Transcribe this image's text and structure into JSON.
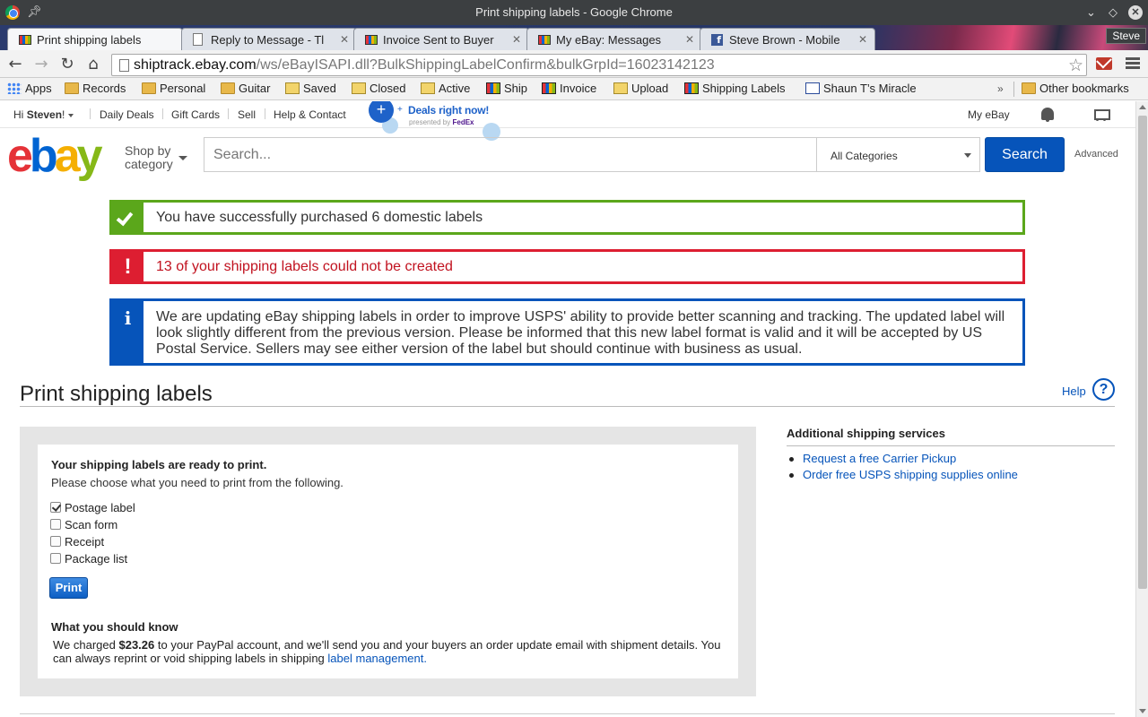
{
  "window": {
    "title": "Print shipping labels - Google Chrome"
  },
  "tabs": [
    {
      "label": "Print shipping labels",
      "icon": "ebay-favicon",
      "active": true
    },
    {
      "label": "Reply to Message - Tl",
      "icon": "page-favicon"
    },
    {
      "label": "Invoice Sent to Buyer",
      "icon": "ebay-favicon"
    },
    {
      "label": "My eBay: Messages",
      "icon": "ebay-favicon"
    },
    {
      "label": "Steve Brown - Mobile",
      "icon": "facebook-favicon"
    }
  ],
  "profile": {
    "name": "Steve"
  },
  "omnibox": {
    "host": "shiptrack.ebay.com",
    "path": "/ws/eBayISAPI.dll?BulkShippingLabelConfirm&bulkGrpId=16023142123"
  },
  "bookmarks": [
    {
      "label": "Apps",
      "icon": "apps"
    },
    {
      "label": "Records",
      "icon": "folder"
    },
    {
      "label": "Personal",
      "icon": "folder"
    },
    {
      "label": "Guitar",
      "icon": "folder"
    },
    {
      "label": "Saved",
      "icon": "graph"
    },
    {
      "label": "Closed",
      "icon": "graph"
    },
    {
      "label": "Active",
      "icon": "graph"
    },
    {
      "label": "Ship",
      "icon": "ebay"
    },
    {
      "label": "Invoice",
      "icon": "ebay"
    },
    {
      "label": "Upload",
      "icon": "graph"
    },
    {
      "label": "Shipping Labels",
      "icon": "ebay"
    },
    {
      "label": "Shaun T’s Miracle",
      "icon": "logo"
    },
    {
      "label": "Other bookmarks",
      "icon": "folder"
    }
  ],
  "bookmarks_more": "»",
  "header": {
    "greeting_prefix": "Hi",
    "user": "Steven",
    "greeting_suffix": "!",
    "links": [
      "Daily Deals",
      "Gift Cards",
      "Sell",
      "Help & Contact"
    ],
    "promo_title": "Deals right now!",
    "promo_sub_prefix": "presented by",
    "promo_sub_brand": "FedEx",
    "my_ebay": "My eBay"
  },
  "logo": {
    "e": "e",
    "b": "b",
    "a": "a",
    "y": "y"
  },
  "search": {
    "shop_by_line1": "Shop by",
    "shop_by_line2": "category",
    "placeholder": "Search...",
    "category": "All Categories",
    "button": "Search",
    "advanced": "Advanced"
  },
  "messages": {
    "success": "You have successfully purchased 6 domestic labels",
    "error": "13 of your shipping labels could not be created",
    "error_icon": "!",
    "info": "We are updating eBay shipping labels in order to improve USPS' ability to provide better scanning and tracking. The updated label will look slightly different from the previous version. Please be informed that this new label format is valid and it will be accepted by US Postal Service. Sellers may see either version of the label but should continue with business as usual.",
    "info_icon": "i"
  },
  "page": {
    "title": "Print shipping labels",
    "help": "Help",
    "help_icon": "?"
  },
  "print_panel": {
    "ready": "Your shipping labels are ready to print.",
    "choose": "Please choose what you need to print from the following.",
    "options": [
      {
        "label": "Postage label",
        "checked": true
      },
      {
        "label": "Scan form",
        "checked": false
      },
      {
        "label": "Receipt",
        "checked": false
      },
      {
        "label": "Package list",
        "checked": false
      }
    ],
    "print_button": "Print",
    "know_title": "What you should know",
    "know_text_1": "We charged",
    "know_amount": "$23.26",
    "know_text_2": "to your PayPal account, and we'll send you and your buyers an order update email with shipment details. You can always reprint or void shipping labels in shipping",
    "know_link": "label management."
  },
  "side": {
    "title": "Additional shipping services",
    "links": [
      "Request a free Carrier Pickup",
      "Order free USPS shipping supplies online"
    ]
  }
}
